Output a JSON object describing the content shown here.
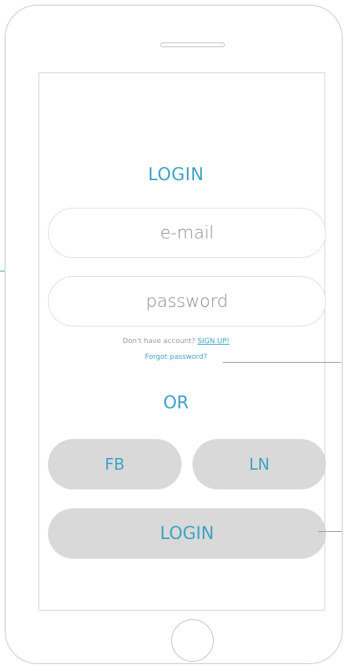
{
  "login_form": {
    "title": "LOGIN",
    "email_placeholder": "e-mail",
    "password_placeholder": "password",
    "no_account_text": "Don't have account?",
    "signup_label": "SIGN UP!",
    "forgot_password_label": "Forgot password?",
    "or_label": "OR",
    "fb_label": "FB",
    "ln_label": "LN",
    "login_button_label": "LOGIN"
  },
  "colors": {
    "accent": "#3fa2c4",
    "button_fill": "#d9d9d9",
    "outline": "#c9c9c9"
  }
}
